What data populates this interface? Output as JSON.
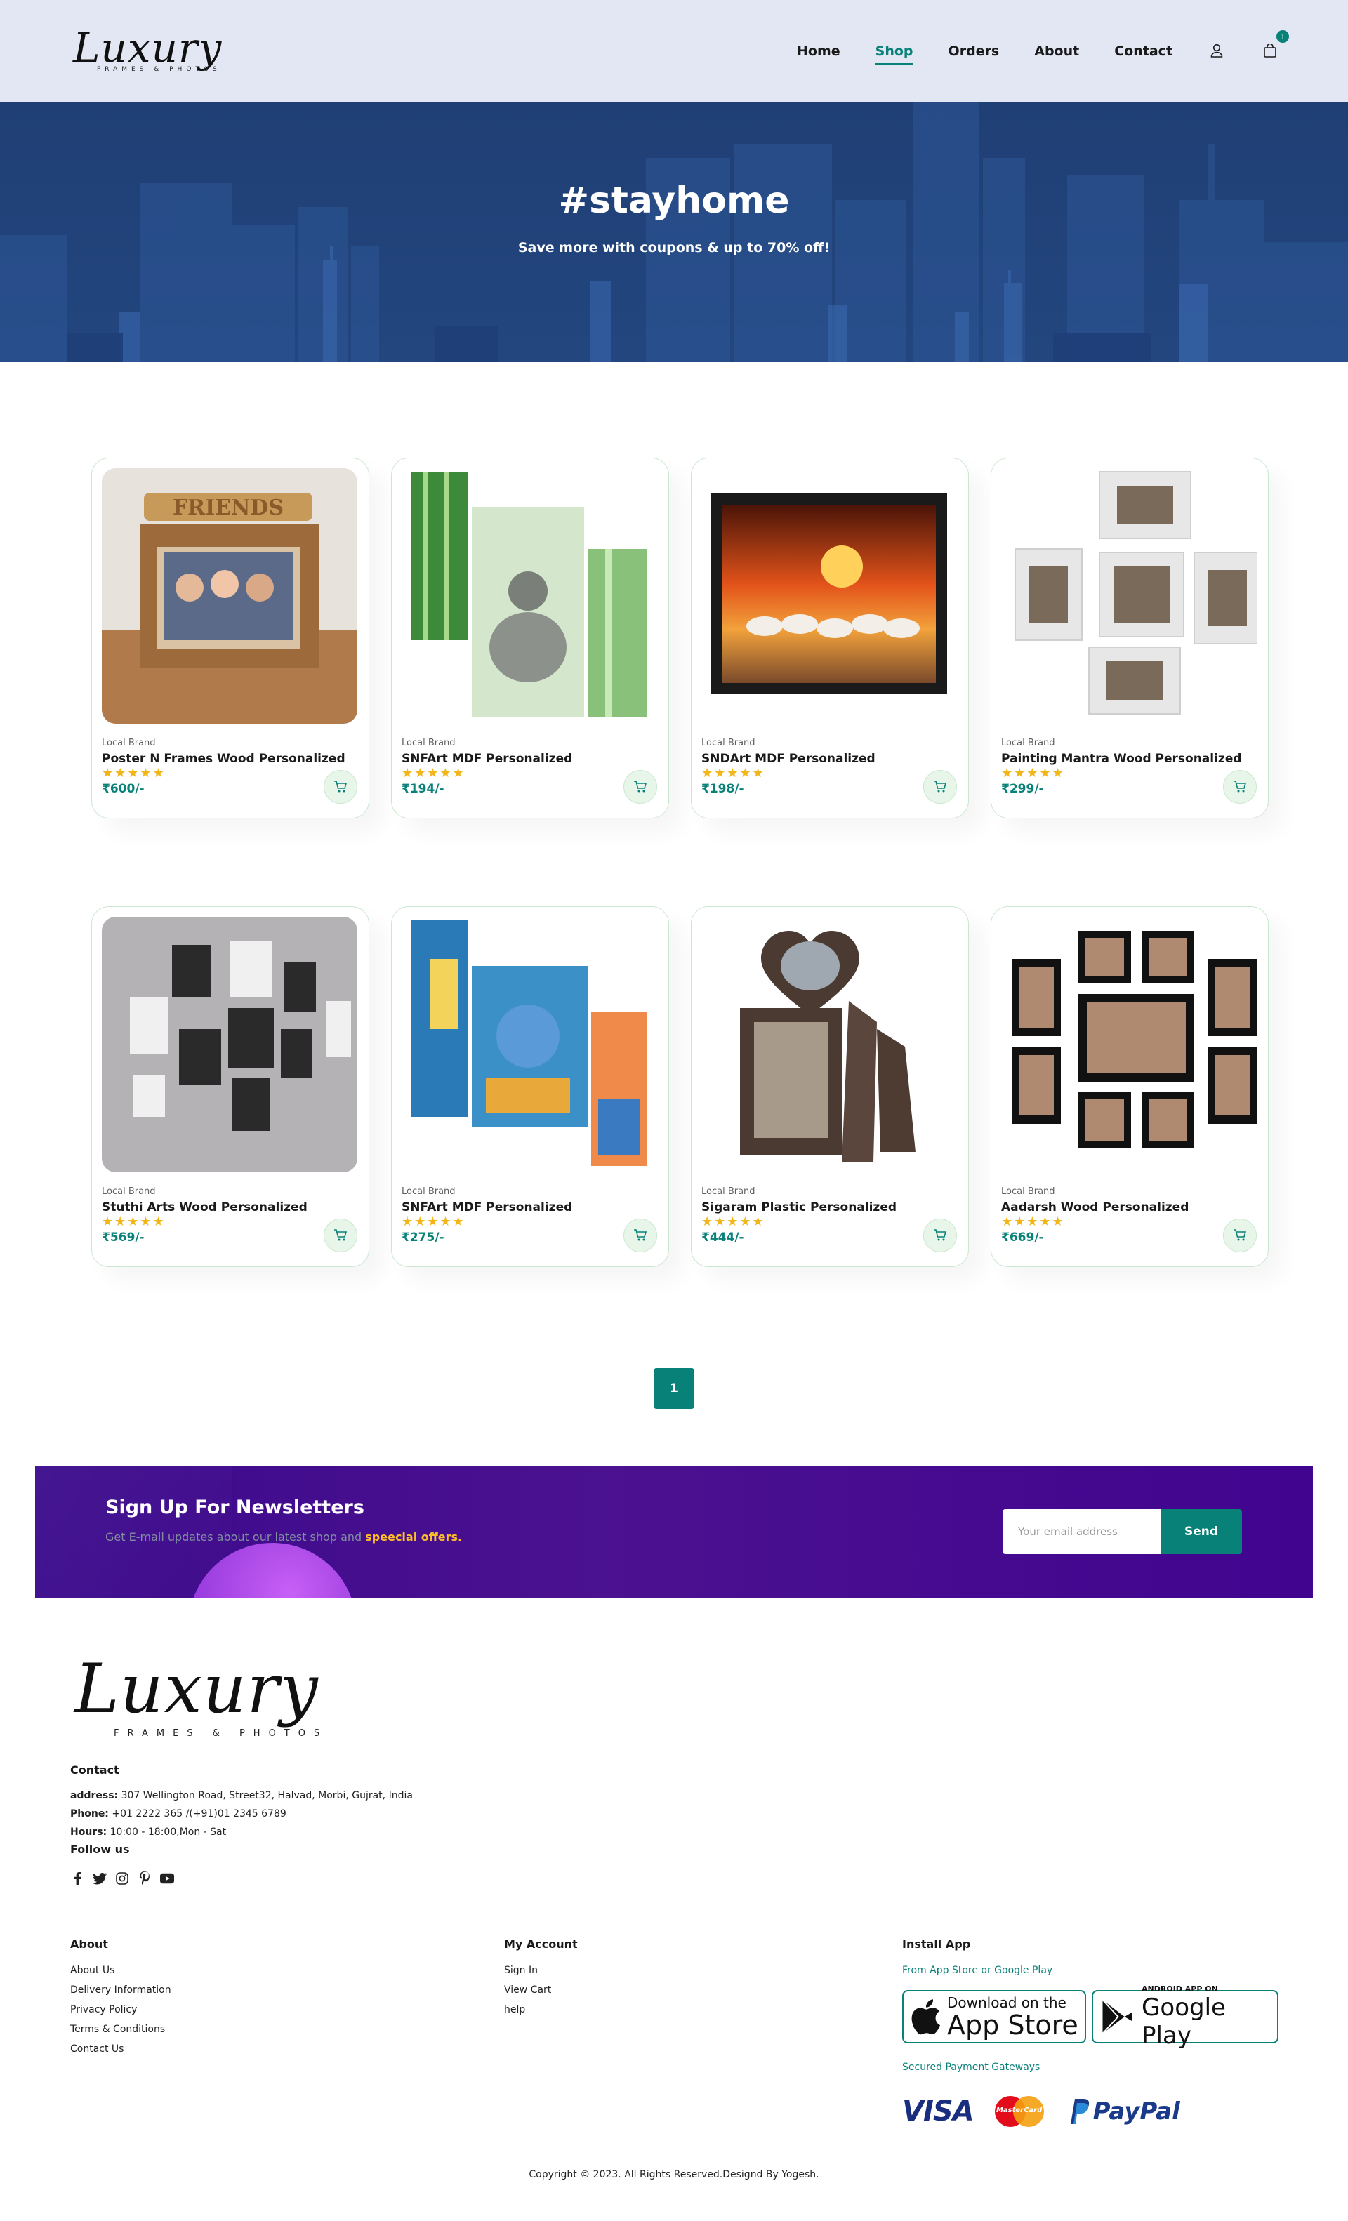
{
  "header": {
    "logo_script": "Luxury",
    "logo_sub": "FRAMES & PHOTOS",
    "nav": [
      {
        "label": "Home",
        "active": false
      },
      {
        "label": "Shop",
        "active": true
      },
      {
        "label": "Orders",
        "active": false
      },
      {
        "label": "About",
        "active": false
      },
      {
        "label": "Contact",
        "active": false
      }
    ],
    "user_icon": "user-icon",
    "cart_icon": "shopping-bag-icon",
    "cart_count": "1"
  },
  "hero": {
    "title": "#stayhome",
    "subtitle": "Save more with coupons & up to 70% off!"
  },
  "products": [
    {
      "brand": "Local Brand",
      "name": "Poster N Frames Wood Personalized",
      "rating": 4.5,
      "stars": "★★★★★",
      "price": "₹600/-"
    },
    {
      "brand": "Local Brand",
      "name": "SNFArt MDF Personalized",
      "rating": 4.5,
      "stars": "★★★★★",
      "price": "₹194/-"
    },
    {
      "brand": "Local Brand",
      "name": "SNDArt MDF Personalized",
      "rating": 4.5,
      "stars": "★★★★★",
      "price": "₹198/-"
    },
    {
      "brand": "Local Brand",
      "name": "Painting Mantra Wood Personalized",
      "rating": 4.5,
      "stars": "★★★★★",
      "price": "₹299/-"
    },
    {
      "brand": "Local Brand",
      "name": "Stuthi Arts Wood Personalized",
      "rating": 4.5,
      "stars": "★★★★★",
      "price": "₹569/-"
    },
    {
      "brand": "Local Brand",
      "name": "SNFArt MDF Personalized",
      "rating": 4.5,
      "stars": "★★★★★",
      "price": "₹275/-"
    },
    {
      "brand": "Local Brand",
      "name": "Sigaram Plastic Personalized",
      "rating": 4.5,
      "stars": "★★★★★",
      "price": "₹444/-"
    },
    {
      "brand": "Local Brand",
      "name": "Aadarsh Wood Personalized",
      "rating": 4.5,
      "stars": "★★★★★",
      "price": "₹669/-"
    }
  ],
  "pagination": {
    "current": "1"
  },
  "newsletter": {
    "title": "Sign Up For Newsletters",
    "text": "Get E-mail updates about our latest shop and",
    "highlight": "speecial offers.",
    "placeholder": "Your email address",
    "button": "Send"
  },
  "footer": {
    "contact_title": "Contact",
    "address_label": "address:",
    "address": "307 Wellington Road, Street32, Halvad, Morbi, Gujrat, India",
    "phone_label": "Phone:",
    "phone": "+01 2222 365 /(+91)01 2345 6789",
    "hours_label": "Hours:",
    "hours": "10:00 - 18:00,Mon - Sat",
    "follow_title": "Follow us",
    "social_icons": [
      "facebook-icon",
      "twitter-icon",
      "instagram-icon",
      "pinterest-icon",
      "youtube-icon"
    ],
    "about_title": "About",
    "about_links": [
      "About Us",
      "Delivery Information",
      "Privacy Policy",
      "Terms & Conditions",
      "Contact Us"
    ],
    "account_title": "My Account",
    "account_links": [
      "Sign In",
      "View Cart",
      "help"
    ],
    "app_title": "Install App",
    "app_text": "From App Store or Google Play",
    "appstore_small": "Download on the",
    "appstore_big": "App Store",
    "google_small": "ANDROID APP ON",
    "google_big": "Google Play",
    "payment_text": "Secured Payment Gateways",
    "payments": [
      "VISA",
      "MasterCard",
      "PayPal"
    ],
    "copyright": "Copyright © 2023. All Rights Reserved.Designd By Yogesh."
  },
  "colors": {
    "accent": "#088178",
    "header_bg": "#e3e6f3",
    "hero_bg": "#1f3f75",
    "newsletter_bg": "#41048f",
    "star": "#f3b619",
    "highlight": "#ffbd27"
  }
}
